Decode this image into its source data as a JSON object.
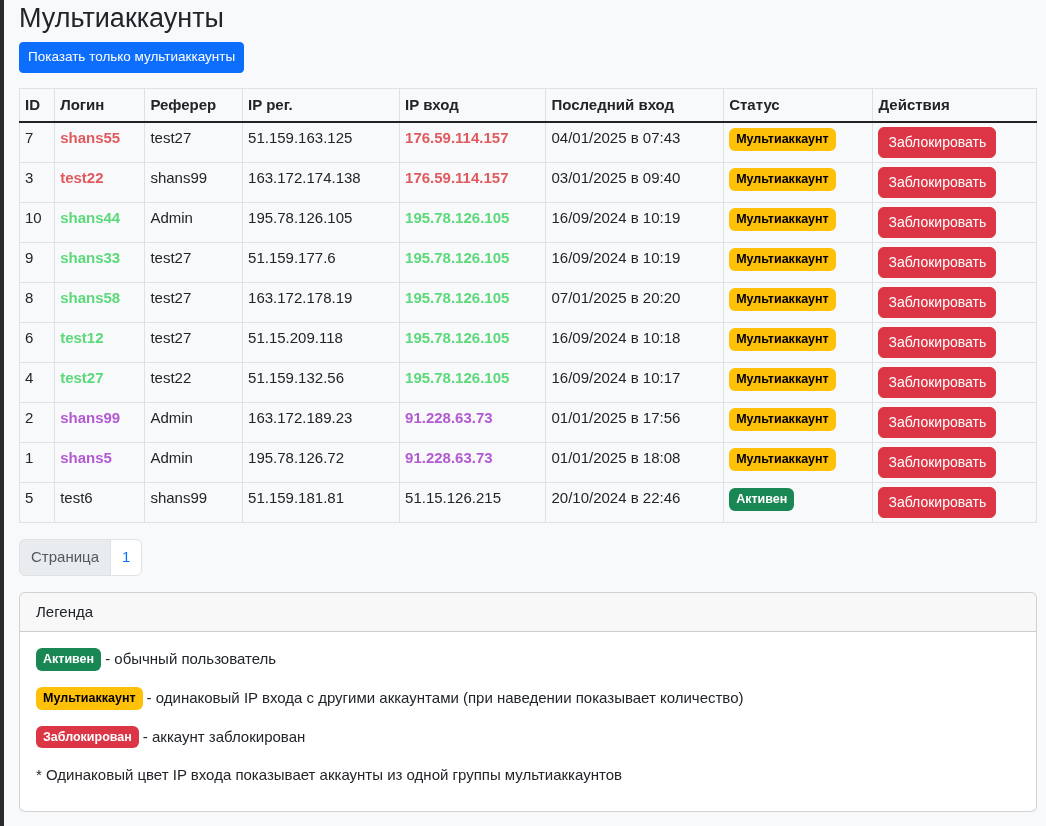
{
  "title": "Мультиаккаунты",
  "filter_button": "Показать только мультиаккаунты",
  "table": {
    "columns": [
      "ID",
      "Логин",
      "Реферер",
      "IP рег.",
      "IP вход",
      "Последний вход",
      "Статус",
      "Действия"
    ],
    "rows": [
      {
        "id": "7",
        "login": "shans55",
        "referer": "test27",
        "ip_reg": "51.159.163.125",
        "ip_login": "176.59.114.157",
        "last_login": "04/01/2025 в 07:43",
        "status": {
          "kind": "multi",
          "label": "Мультиаккаунт"
        },
        "color": "#e05a5f",
        "action": "Заблокировать"
      },
      {
        "id": "3",
        "login": "test22",
        "referer": "shans99",
        "ip_reg": "163.172.174.138",
        "ip_login": "176.59.114.157",
        "last_login": "03/01/2025 в 09:40",
        "status": {
          "kind": "multi",
          "label": "Мультиаккаунт"
        },
        "color": "#e05a5f",
        "action": "Заблокировать"
      },
      {
        "id": "10",
        "login": "shans44",
        "referer": "Admin",
        "ip_reg": "195.78.126.105",
        "ip_login": "195.78.126.105",
        "last_login": "16/09/2024 в 10:19",
        "status": {
          "kind": "multi",
          "label": "Мультиаккаунт"
        },
        "color": "#5cd97a",
        "action": "Заблокировать"
      },
      {
        "id": "9",
        "login": "shans33",
        "referer": "test27",
        "ip_reg": "51.159.177.6",
        "ip_login": "195.78.126.105",
        "last_login": "16/09/2024 в 10:19",
        "status": {
          "kind": "multi",
          "label": "Мультиаккаунт"
        },
        "color": "#5cd97a",
        "action": "Заблокировать"
      },
      {
        "id": "8",
        "login": "shans58",
        "referer": "test27",
        "ip_reg": "163.172.178.19",
        "ip_login": "195.78.126.105",
        "last_login": "07/01/2025 в 20:20",
        "status": {
          "kind": "multi",
          "label": "Мультиаккаунт"
        },
        "color": "#5cd97a",
        "action": "Заблокировать"
      },
      {
        "id": "6",
        "login": "test12",
        "referer": "test27",
        "ip_reg": "51.15.209.118",
        "ip_login": "195.78.126.105",
        "last_login": "16/09/2024 в 10:18",
        "status": {
          "kind": "multi",
          "label": "Мультиаккаунт"
        },
        "color": "#5cd97a",
        "action": "Заблокировать"
      },
      {
        "id": "4",
        "login": "test27",
        "referer": "test22",
        "ip_reg": "51.159.132.56",
        "ip_login": "195.78.126.105",
        "last_login": "16/09/2024 в 10:17",
        "status": {
          "kind": "multi",
          "label": "Мультиаккаунт"
        },
        "color": "#5cd97a",
        "action": "Заблокировать"
      },
      {
        "id": "2",
        "login": "shans99",
        "referer": "Admin",
        "ip_reg": "163.172.189.23",
        "ip_login": "91.228.63.73",
        "last_login": "01/01/2025 в 17:56",
        "status": {
          "kind": "multi",
          "label": "Мультиаккаунт"
        },
        "color": "#b25ad2",
        "action": "Заблокировать"
      },
      {
        "id": "1",
        "login": "shans5",
        "referer": "Admin",
        "ip_reg": "195.78.126.72",
        "ip_login": "91.228.63.73",
        "last_login": "01/01/2025 в 18:08",
        "status": {
          "kind": "multi",
          "label": "Мультиаккаунт"
        },
        "color": "#b25ad2",
        "action": "Заблокировать"
      },
      {
        "id": "5",
        "login": "test6",
        "referer": "shans99",
        "ip_reg": "51.159.181.81",
        "ip_login": "51.15.126.215",
        "last_login": "20/10/2024 в 22:46",
        "status": {
          "kind": "active",
          "label": "Активен"
        },
        "action": "Заблокировать"
      }
    ]
  },
  "pagination": {
    "label": "Страница",
    "pages": [
      {
        "label": "1",
        "selected": true
      }
    ]
  },
  "legend": {
    "title": "Легенда",
    "items": [
      {
        "kind": "active",
        "badge": "Активен",
        "text": "- обычный пользователь"
      },
      {
        "kind": "multi",
        "badge": "Мультиаккаунт",
        "text": "- одинаковый IP входа с другими аккаунтами (при наведении показывает количество)"
      },
      {
        "kind": "blocked",
        "badge": "Заблокирован",
        "text": "- аккаунт заблокирован"
      }
    ],
    "note": "* Одинаковый цвет IP входа показывает аккаунты из одной группы мультиаккаунтов"
  }
}
